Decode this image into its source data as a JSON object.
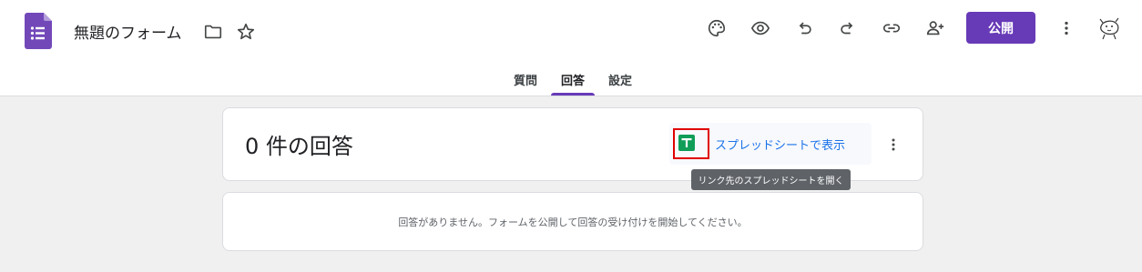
{
  "header": {
    "title": "無題のフォーム",
    "publish_label": "公開",
    "icons": [
      "forms-logo-icon",
      "folder-icon",
      "star-icon",
      "palette-icon",
      "preview-eye-icon",
      "undo-icon",
      "redo-icon",
      "link-icon",
      "add-collaborator-icon",
      "more-vert-icon",
      "avatar"
    ]
  },
  "tabs": {
    "items": [
      {
        "label": "質問"
      },
      {
        "label": "回答"
      },
      {
        "label": "設定"
      }
    ],
    "active": "回答"
  },
  "responses": {
    "count_label": "0 件の回答",
    "sheets_link_label": "スプレッドシートで表示",
    "tooltip": "リンク先のスプレッドシートを開く",
    "empty_message": "回答がありません。フォームを公開して回答の受け付けを開始してください。"
  },
  "colors": {
    "accent": "#673ab7",
    "sheets_green": "#0f9d58",
    "link_blue": "#1a73e8",
    "highlight_red": "#e00000"
  }
}
